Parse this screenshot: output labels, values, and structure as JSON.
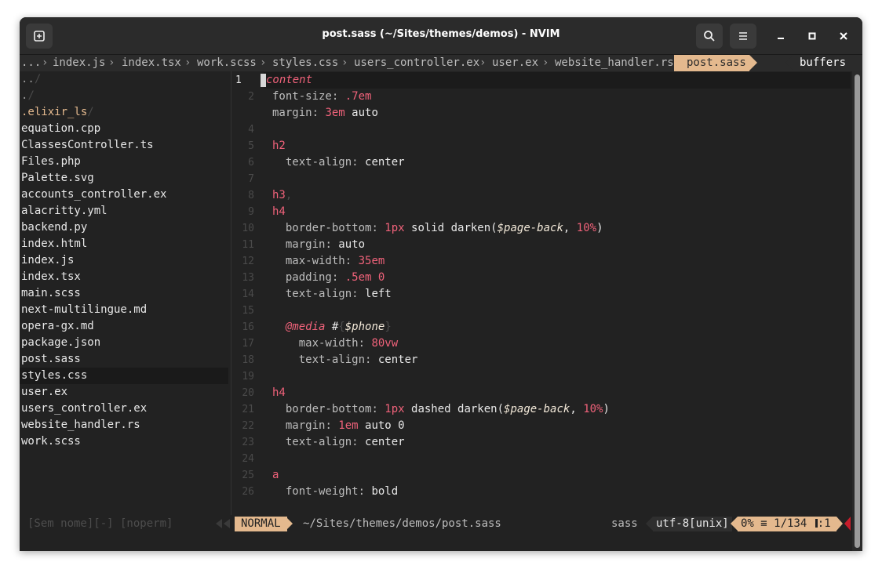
{
  "window": {
    "title": "post.sass (~/Sites/themes/demos) - NVIM",
    "new_tab_icon": "new-tab-icon",
    "search_icon": "search-icon",
    "menu_icon": "hamburger-menu-icon"
  },
  "tabline": {
    "overflow": "...",
    "tabs": [
      "index.js",
      "index.tsx",
      "work.scss",
      "styles.css",
      "users_controller.ex",
      "user.ex",
      "website_handler.rs"
    ],
    "active": "post.sass",
    "buffers_label": "buffers"
  },
  "tree": {
    "items": [
      {
        "name": "..",
        "suffix": "/"
      },
      {
        "name": ".",
        "suffix": "/"
      },
      {
        "name": ".elixir_ls",
        "suffix": "/"
      },
      {
        "name": "equation.cpp",
        "suffix": ""
      },
      {
        "name": "ClassesController.ts",
        "suffix": ""
      },
      {
        "name": "Files.php",
        "suffix": ""
      },
      {
        "name": "Palette.svg",
        "suffix": ""
      },
      {
        "name": "accounts_controller.ex",
        "suffix": ""
      },
      {
        "name": "alacritty.yml",
        "suffix": ""
      },
      {
        "name": "backend.py",
        "suffix": ""
      },
      {
        "name": "index.html",
        "suffix": ""
      },
      {
        "name": "index.js",
        "suffix": ""
      },
      {
        "name": "index.tsx",
        "suffix": ""
      },
      {
        "name": "main.scss",
        "suffix": ""
      },
      {
        "name": "next-multilingue.md",
        "suffix": ""
      },
      {
        "name": "opera-gx.md",
        "suffix": ""
      },
      {
        "name": "package.json",
        "suffix": ""
      },
      {
        "name": "post.sass",
        "suffix": ""
      },
      {
        "name": "styles.css",
        "suffix": ""
      },
      {
        "name": "user.ex",
        "suffix": ""
      },
      {
        "name": "users_controller.ex",
        "suffix": ""
      },
      {
        "name": "website_handler.rs",
        "suffix": ""
      },
      {
        "name": "work.scss",
        "suffix": ""
      }
    ],
    "selected": "post.sass"
  },
  "editor": {
    "current_line_number": "1",
    "line_numbers": [
      "1",
      "2",
      "",
      "4",
      "5",
      "6",
      "7",
      "8",
      "9",
      "10",
      "11",
      "12",
      "13",
      "14",
      "15",
      "16",
      "17",
      "18",
      "19",
      "20",
      "21",
      "22",
      "23",
      "24",
      "25",
      "26"
    ],
    "lines": [
      [
        {
          "t": "content",
          "c": "sel"
        }
      ],
      [
        {
          "t": "font-size",
          "c": "prop"
        },
        {
          "t": ": ",
          "c": "punct"
        },
        {
          "t": ".7",
          "c": "num"
        },
        {
          "t": "em",
          "c": "unit"
        }
      ],
      [
        {
          "t": "margin",
          "c": "prop"
        },
        {
          "t": ": ",
          "c": "punct"
        },
        {
          "t": "3",
          "c": "num"
        },
        {
          "t": "em",
          "c": "unit"
        },
        {
          "t": " auto",
          "c": "val"
        }
      ],
      [],
      [
        {
          "t": "h2",
          "c": "tag"
        }
      ],
      [
        {
          "t": "  text-align",
          "c": "prop"
        },
        {
          "t": ": ",
          "c": "punct"
        },
        {
          "t": "center",
          "c": "val"
        }
      ],
      [],
      [
        {
          "t": "h3",
          "c": "tag"
        },
        {
          "t": ",",
          "c": "dim"
        }
      ],
      [
        {
          "t": "h4",
          "c": "tag"
        }
      ],
      [
        {
          "t": "  border-bottom",
          "c": "prop"
        },
        {
          "t": ": ",
          "c": "punct"
        },
        {
          "t": "1",
          "c": "num"
        },
        {
          "t": "px",
          "c": "unit"
        },
        {
          "t": " solid darken(",
          "c": "val"
        },
        {
          "t": "$page-back",
          "c": "var"
        },
        {
          "t": ", ",
          "c": "val"
        },
        {
          "t": "10",
          "c": "num"
        },
        {
          "t": "%",
          "c": "unit"
        },
        {
          "t": ")",
          "c": "val"
        }
      ],
      [
        {
          "t": "  margin",
          "c": "prop"
        },
        {
          "t": ": ",
          "c": "punct"
        },
        {
          "t": "auto",
          "c": "val"
        }
      ],
      [
        {
          "t": "  max-width",
          "c": "prop"
        },
        {
          "t": ": ",
          "c": "punct"
        },
        {
          "t": "35",
          "c": "num"
        },
        {
          "t": "em",
          "c": "unit"
        }
      ],
      [
        {
          "t": "  padding",
          "c": "prop"
        },
        {
          "t": ": ",
          "c": "punct"
        },
        {
          "t": ".5",
          "c": "num"
        },
        {
          "t": "em",
          "c": "unit"
        },
        {
          "t": " 0",
          "c": "num"
        }
      ],
      [
        {
          "t": "  text-align",
          "c": "prop"
        },
        {
          "t": ": ",
          "c": "punct"
        },
        {
          "t": "left",
          "c": "val"
        }
      ],
      [],
      [
        {
          "t": "  @media",
          "c": "at"
        },
        {
          "t": " #",
          "c": "val"
        },
        {
          "t": "{",
          "c": "dim"
        },
        {
          "t": "$phone",
          "c": "var"
        },
        {
          "t": "}",
          "c": "dim"
        }
      ],
      [
        {
          "t": "    max-width",
          "c": "prop"
        },
        {
          "t": ": ",
          "c": "punct"
        },
        {
          "t": "80",
          "c": "num"
        },
        {
          "t": "vw",
          "c": "unit"
        }
      ],
      [
        {
          "t": "    text-align",
          "c": "prop"
        },
        {
          "t": ": ",
          "c": "punct"
        },
        {
          "t": "center",
          "c": "val"
        }
      ],
      [],
      [
        {
          "t": "h4",
          "c": "tag"
        }
      ],
      [
        {
          "t": "  border-bottom",
          "c": "prop"
        },
        {
          "t": ": ",
          "c": "punct"
        },
        {
          "t": "1",
          "c": "num"
        },
        {
          "t": "px",
          "c": "unit"
        },
        {
          "t": " dashed darken(",
          "c": "val"
        },
        {
          "t": "$page-back",
          "c": "var"
        },
        {
          "t": ", ",
          "c": "val"
        },
        {
          "t": "10",
          "c": "num"
        },
        {
          "t": "%",
          "c": "unit"
        },
        {
          "t": ")",
          "c": "val"
        }
      ],
      [
        {
          "t": "  margin",
          "c": "prop"
        },
        {
          "t": ": ",
          "c": "punct"
        },
        {
          "t": "1",
          "c": "num"
        },
        {
          "t": "em",
          "c": "unit"
        },
        {
          "t": " auto 0",
          "c": "val"
        }
      ],
      [
        {
          "t": "  text-align",
          "c": "prop"
        },
        {
          "t": ": ",
          "c": "punct"
        },
        {
          "t": "center",
          "c": "val"
        }
      ],
      [],
      [
        {
          "t": "a",
          "c": "tag"
        }
      ],
      [
        {
          "t": "  font-weight",
          "c": "prop"
        },
        {
          "t": ": ",
          "c": "punct"
        },
        {
          "t": "bold",
          "c": "val"
        }
      ],
      []
    ]
  },
  "statusline": {
    "left_info": "[Sem nome][-] [noperm]",
    "mode": "NORMAL",
    "path": "~/Sites/themes/demos/post.sass",
    "filetype": "sass",
    "encoding": "utf-8[unix]",
    "percent": "0%",
    "position": "1/134",
    "column": ":1",
    "position_icon": "line-number-icon",
    "column_icon": "column-icon"
  },
  "colors": {
    "accent": "#e4b98e",
    "keyword_pink": "#f0627a",
    "text": "#e8e8e8",
    "comment": "#4a4a4a",
    "error_red": "#c71d2b"
  }
}
